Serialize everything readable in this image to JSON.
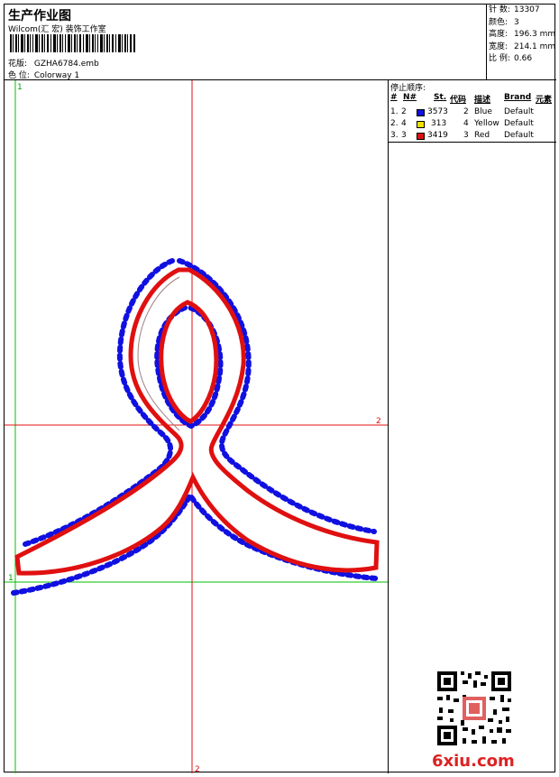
{
  "header": {
    "title": "生产作业图",
    "company": "Wilcom(汇 宏) 装饰工作室",
    "pattern_label": "花版:",
    "pattern_value": "GZHA6784.emb",
    "colorway_label": "色 位:",
    "colorway_value": "Colorway 1"
  },
  "stats": {
    "stitches_label": "针 数:",
    "stitches_value": "13307",
    "colors_label": "颜色:",
    "colors_value": "3",
    "height_label": "高度:",
    "height_value": "196.3 mm",
    "width_label": "宽度:",
    "width_value": "214.1 mm",
    "scale_label": "比 例:",
    "scale_value": "0.66"
  },
  "stop_sequence": {
    "title": "停止顺序:",
    "headers": {
      "num": "#",
      "n": "N#",
      "st": "St.",
      "code": "代码",
      "desc": "描述",
      "brand": "Brand",
      "element": "元素"
    },
    "rows": [
      {
        "num": "1.",
        "n": "2",
        "st": "3573",
        "code": "2",
        "desc": "Blue",
        "brand": "Default",
        "color": "#1010e0"
      },
      {
        "num": "2.",
        "n": "4",
        "st": "313",
        "code": "4",
        "desc": "Yellow",
        "brand": "Default",
        "color": "#f0e000"
      },
      {
        "num": "3.",
        "n": "3",
        "st": "3419",
        "code": "3",
        "desc": "Red",
        "brand": "Default",
        "color": "#e01010"
      }
    ]
  },
  "axes": {
    "top_left_label": "1",
    "left_mid_label": "1",
    "right_mid_label": "2",
    "bottom_label": "2"
  },
  "watermark": "6xiu.com",
  "colors": {
    "red": "#e01010",
    "blue": "#1010e0",
    "green": "#00c000"
  }
}
